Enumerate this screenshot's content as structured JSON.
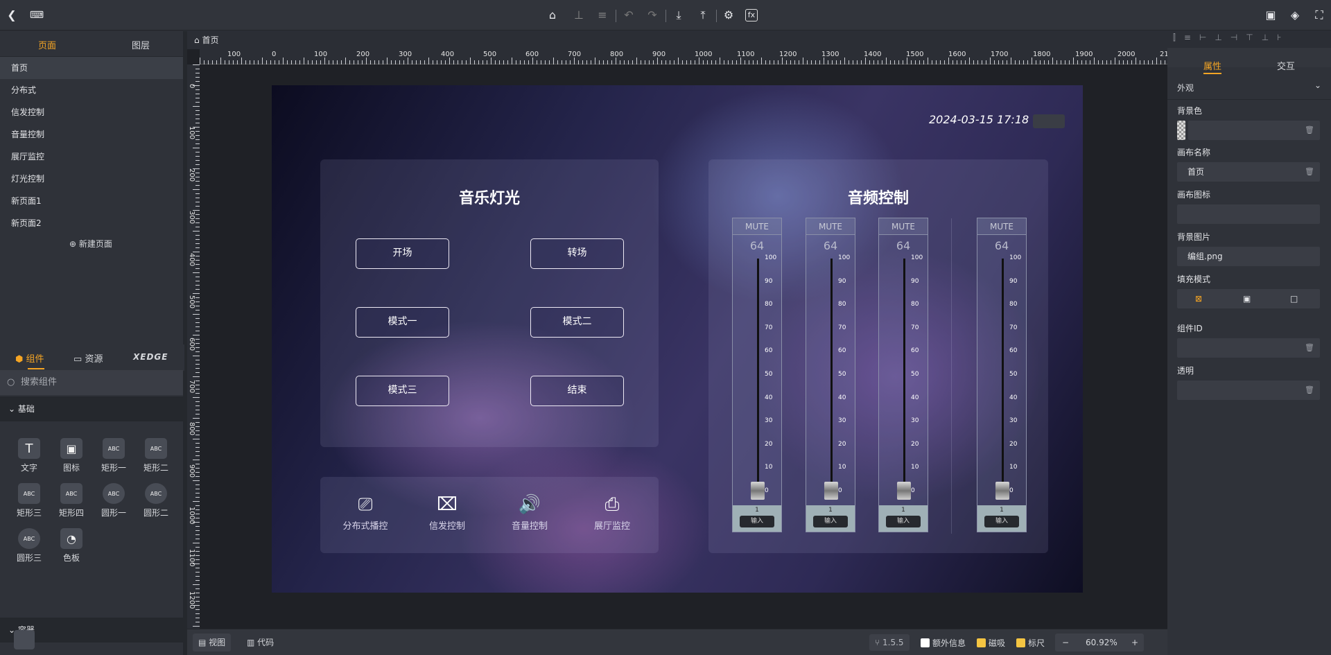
{
  "toolbar": {
    "back_icon": "chevron-left-icon",
    "keyboard_icon": "keyboard-icon",
    "tools": [
      "brush-icon",
      "align-icon",
      "layer-down-icon",
      "undo-icon",
      "redo-icon",
      "download-icon",
      "upload-icon",
      "settings-icon",
      "formula-icon"
    ],
    "right_tools": [
      "save-icon",
      "layers-icon",
      "fullscreen-icon"
    ]
  },
  "left": {
    "tabs": [
      "页面",
      "图层"
    ],
    "pages": [
      "首页",
      "分布式",
      "信发控制",
      "音量控制",
      "展厅监控",
      "灯光控制",
      "新页面1",
      "新页面2"
    ],
    "new_page": "新建页面",
    "comp_tabs": [
      "组件",
      "资源"
    ],
    "brand": "XEDGE",
    "search_placeholder": "搜索组件",
    "section_basic": "基础",
    "components": [
      {
        "label": "文字",
        "icon": "T"
      },
      {
        "label": "图标",
        "icon": "▣"
      },
      {
        "label": "矩形一",
        "icon": "ABC"
      },
      {
        "label": "矩形二",
        "icon": "ABC"
      },
      {
        "label": "矩形三",
        "icon": "ABC"
      },
      {
        "label": "矩形四",
        "icon": "ABC"
      },
      {
        "label": "圆形一",
        "icon": "ABC"
      },
      {
        "label": "圆形二",
        "icon": "ABC"
      },
      {
        "label": "圆形三",
        "icon": "ABC"
      },
      {
        "label": "色板",
        "icon": "◔"
      }
    ],
    "section_container": "容器"
  },
  "breadcrumb": "首页",
  "ruler": {
    "h_labels": [
      "100",
      "0",
      "100",
      "200",
      "300",
      "400",
      "500",
      "600",
      "700",
      "800",
      "900",
      "1000",
      "1100",
      "1200",
      "1300",
      "1400",
      "1500",
      "1600",
      "1700",
      "1800",
      "1900",
      "2000",
      "2100"
    ],
    "v_labels": [
      "0",
      "100",
      "200",
      "300",
      "400",
      "500",
      "600",
      "700",
      "800",
      "900",
      "1000",
      "1100",
      "1200"
    ]
  },
  "stage": {
    "datetime": "2024-03-15 17:18",
    "music": {
      "title": "音乐灯光",
      "buttons": [
        "开场",
        "转场",
        "模式一",
        "模式二",
        "模式三",
        "结束"
      ]
    },
    "nav": [
      "分布式播控",
      "信发控制",
      "音量控制",
      "展厅监控"
    ],
    "audio": {
      "title": "音频控制",
      "mute": "MUTE",
      "value": "64",
      "scale": [
        "100",
        "90",
        "80",
        "70",
        "60",
        "50",
        "40",
        "30",
        "20",
        "10",
        "0"
      ],
      "channel": "1",
      "input_label": "输入"
    }
  },
  "right": {
    "tabs": [
      "属性",
      "交互"
    ],
    "section": "外观",
    "bg_color_label": "背景色",
    "canvas_name_label": "画布名称",
    "canvas_name": "首页",
    "canvas_icon_label": "画布图标",
    "bg_image_label": "背景图片",
    "bg_image": "编组.png",
    "fill_mode_label": "填充模式",
    "component_id_label": "组件ID",
    "transparent_label": "透明"
  },
  "bottom": {
    "view": "视图",
    "code": "代码",
    "version": "1.5.5",
    "extra_info": "额外信息",
    "snap": "磁吸",
    "ruler": "标尺",
    "zoom": "60.92%"
  },
  "colors": {
    "accent": "#f5a524",
    "stage_dark": "#0c0c20",
    "panel": "#3a3d45"
  }
}
